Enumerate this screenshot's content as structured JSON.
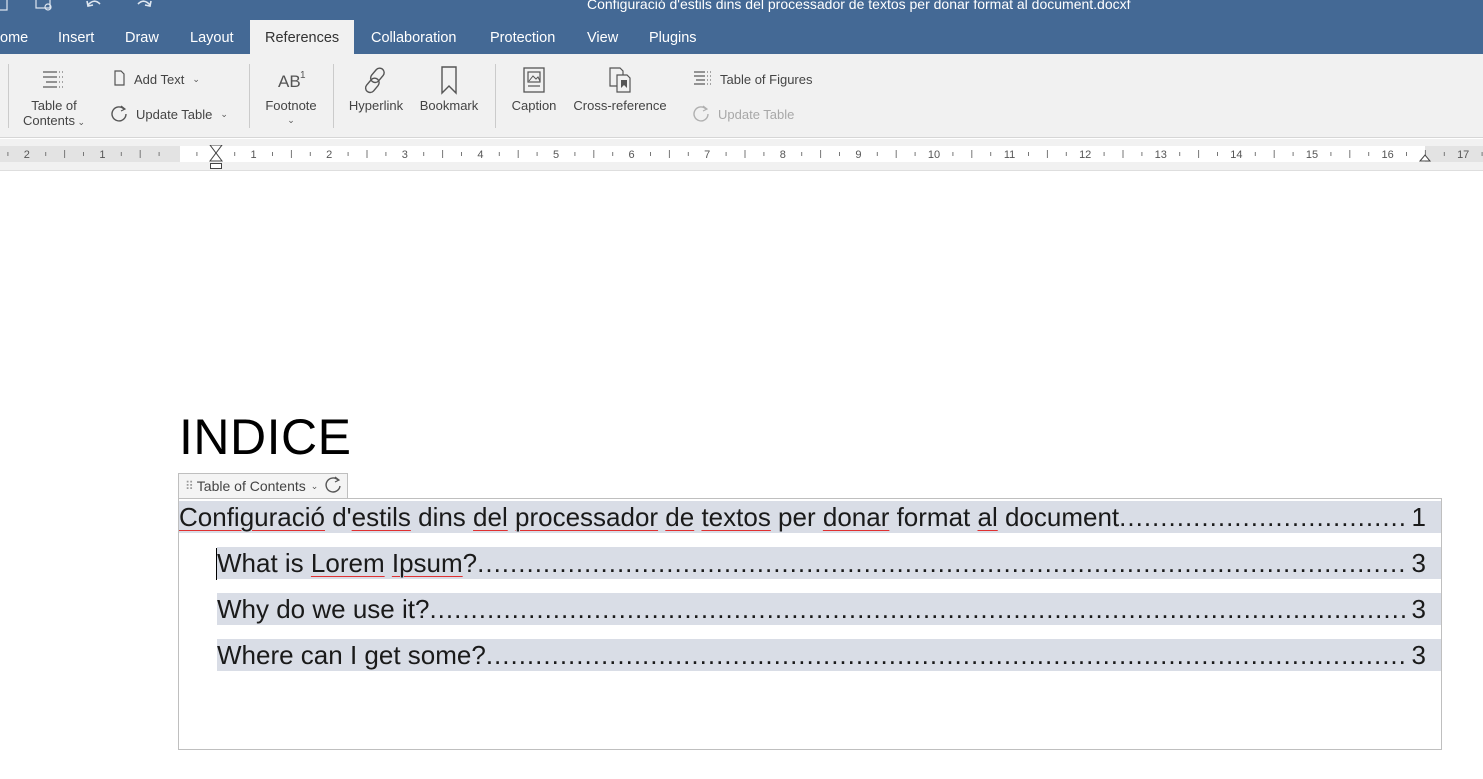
{
  "window": {
    "title": "Configuració d'estils dins del processador de textos per donar format al document.docxf"
  },
  "tabs": [
    {
      "label": "ome",
      "active": false
    },
    {
      "label": "Insert",
      "active": false
    },
    {
      "label": "Draw",
      "active": false
    },
    {
      "label": "Layout",
      "active": false
    },
    {
      "label": "References",
      "active": true
    },
    {
      "label": "Collaboration",
      "active": false
    },
    {
      "label": "Protection",
      "active": false
    },
    {
      "label": "View",
      "active": false
    },
    {
      "label": "Plugins",
      "active": false
    }
  ],
  "toolbar": {
    "toc_line1": "Table of",
    "toc_line2": "Contents",
    "add_text": "Add Text",
    "update_table": "Update Table",
    "footnote": "Footnote",
    "hyperlink": "Hyperlink",
    "bookmark": "Bookmark",
    "caption": "Caption",
    "cross_reference": "Cross-reference",
    "table_of_figures": "Table of Figures",
    "update_table_figures": "Update Table"
  },
  "ruler": {
    "left_labels": [
      "2",
      "1"
    ],
    "right_labels": [
      "1",
      "2",
      "3",
      "4",
      "5",
      "6",
      "7",
      "8",
      "9",
      "10",
      "11",
      "12",
      "13",
      "14",
      "15",
      "16",
      "17"
    ]
  },
  "document": {
    "heading": "INDICE",
    "toc_control_label": "Table of Contents",
    "toc_entries": [
      {
        "text": "Configuració d'estils dins del processador de textos per donar format al document",
        "page": "1",
        "level": 1
      },
      {
        "text": "What is Lorem Ipsum?",
        "page": "3",
        "level": 2
      },
      {
        "text": "Why do we use it?",
        "page": "3",
        "level": 2
      },
      {
        "text": "Where can I get some?",
        "page": "3",
        "level": 2
      }
    ]
  },
  "colors": {
    "header_blue": "#446995",
    "toolbar_bg": "#f1f1f1",
    "toc_highlight": "#d9dde6",
    "spell_underline": "#e03030"
  }
}
